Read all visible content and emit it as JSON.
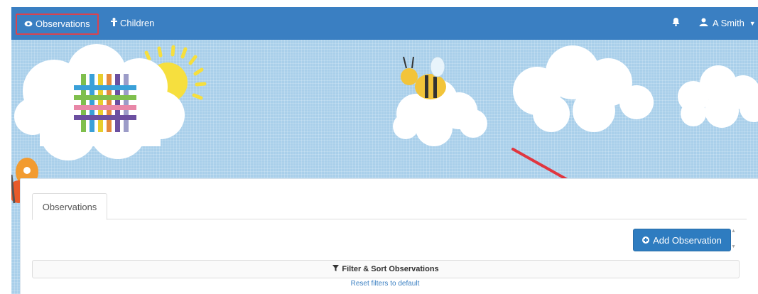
{
  "navbar": {
    "items": [
      {
        "label": "Observations",
        "icon": "eye-icon"
      },
      {
        "label": "Children",
        "icon": "child-icon"
      }
    ],
    "bell_icon": "bell-icon",
    "user": {
      "name": "A Smith",
      "icon": "user-icon"
    },
    "active_highlight_color": "#d9434f",
    "bar_color": "#3a7fc2"
  },
  "main": {
    "tabs": [
      {
        "label": "Observations"
      }
    ],
    "add_button": {
      "label": "Add Observation",
      "icon": "plus-icon"
    },
    "filter": {
      "label": "Filter & Sort Observations",
      "icon": "filter-icon"
    },
    "reset_link": "Reset filters to default"
  },
  "annotation": {
    "arrow_color": "#e0363f"
  }
}
